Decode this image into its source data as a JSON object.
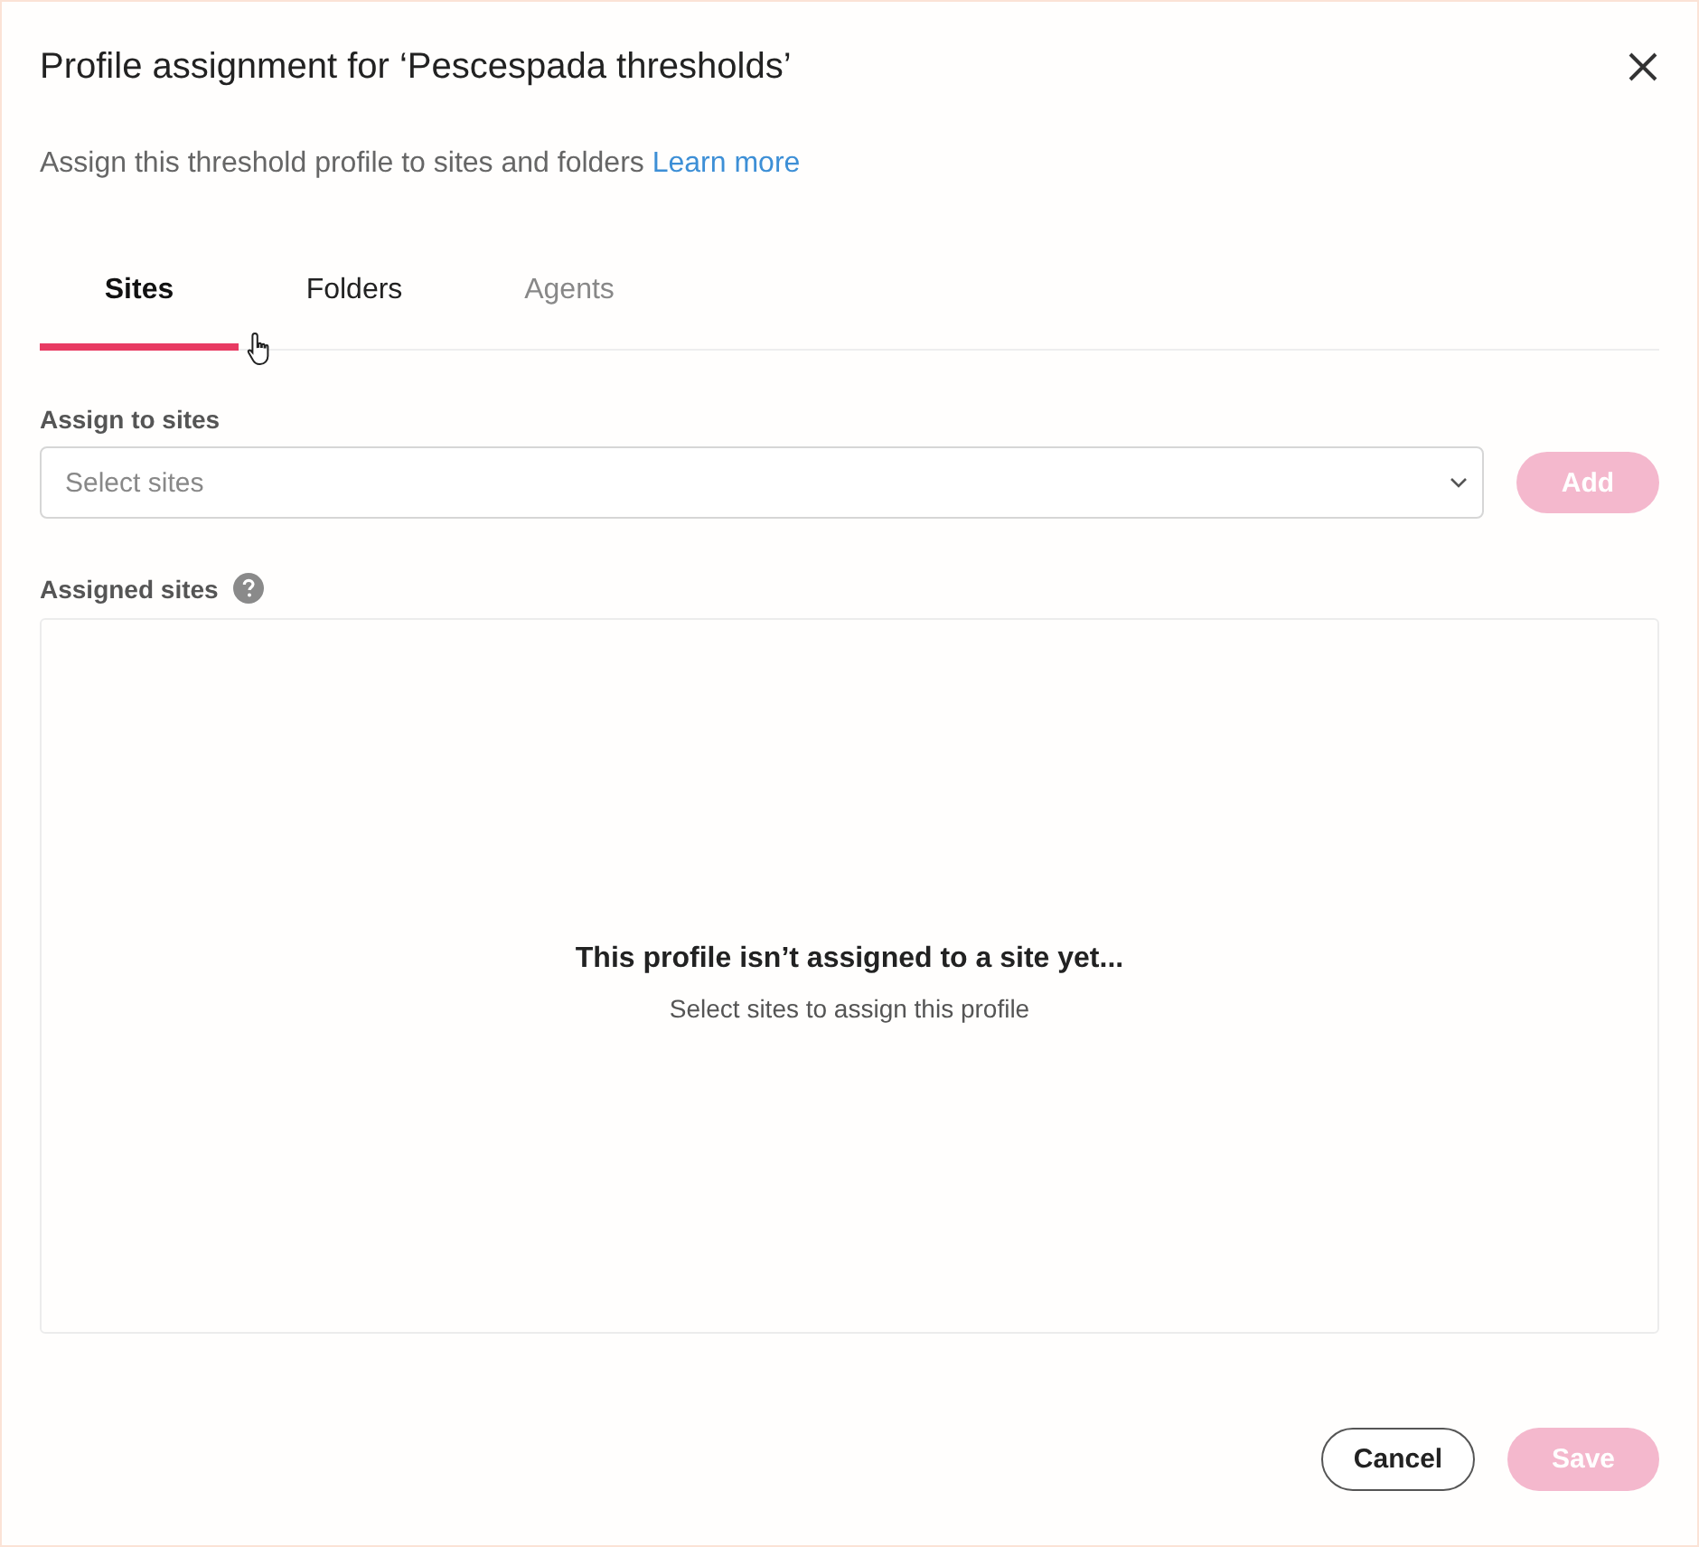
{
  "dialog": {
    "title": "Profile assignment for ‘Pescespada thresholds’",
    "subtitle": "Assign this threshold profile to sites and folders",
    "learn_more": "Learn more"
  },
  "tabs": [
    {
      "label": "Sites",
      "selected": true
    },
    {
      "label": "Folders",
      "selected": false
    },
    {
      "label": "Agents",
      "selected": false
    }
  ],
  "assign": {
    "label": "Assign to sites",
    "placeholder": "Select sites",
    "add_button": {
      "label": "Add",
      "disabled": true
    }
  },
  "assigned": {
    "label": "Assigned sites",
    "empty_title": "This profile isn’t assigned to a site yet...",
    "empty_text": "Select sites to assign this profile"
  },
  "footer": [
    {
      "label": "Cancel",
      "kind": "secondary",
      "disabled": false
    },
    {
      "label": "Save",
      "kind": "primary",
      "disabled": true
    }
  ]
}
